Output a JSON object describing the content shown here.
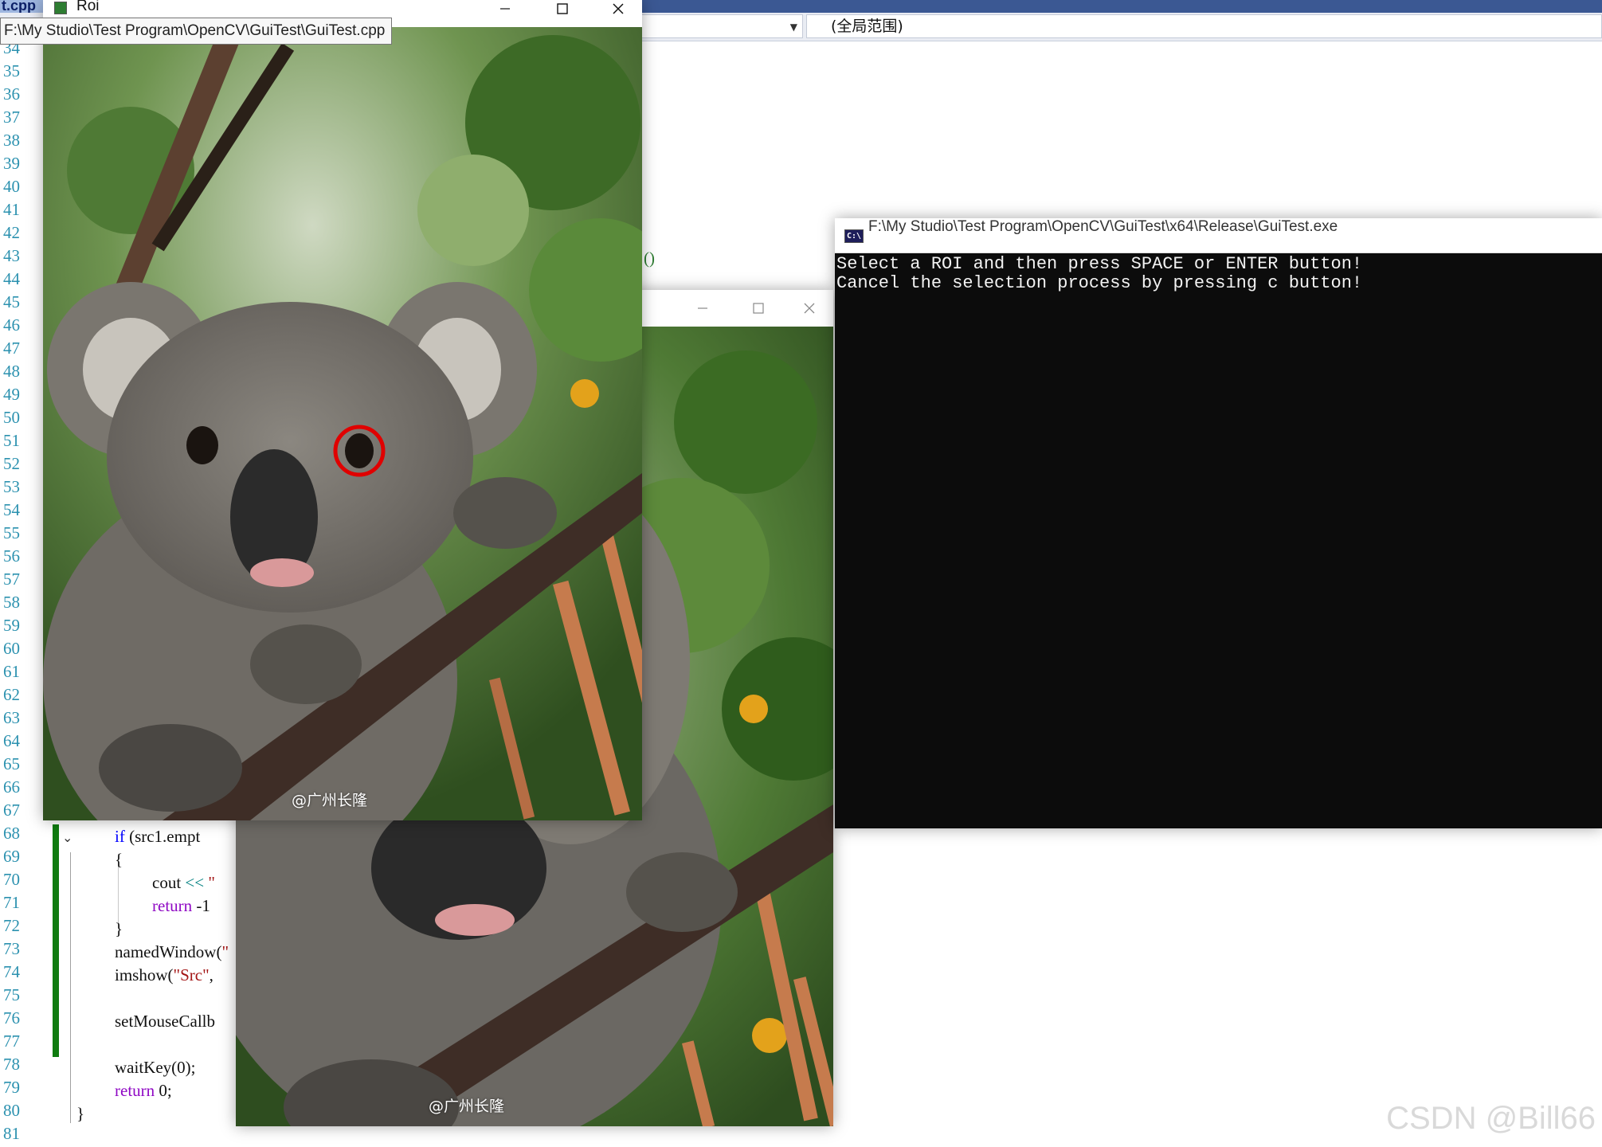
{
  "ide": {
    "file_tab_fragment": "t.cpp",
    "scope_dropdown": "(全局范围)",
    "line_numbers": [
      "34",
      "35",
      "36",
      "37",
      "38",
      "39",
      "40",
      "41",
      "42",
      "43",
      "44",
      "45",
      "46",
      "47",
      "48",
      "49",
      "50",
      "51",
      "52",
      "53",
      "54",
      "55",
      "56",
      "57",
      "58",
      "59",
      "60",
      "61",
      "62",
      "63",
      "64",
      "65",
      "66",
      "67",
      "68",
      "69",
      "70",
      "71",
      "72",
      "73",
      "74",
      "75",
      "76",
      "77",
      "78",
      "79",
      "80",
      "81"
    ],
    "hidden_line_fragment": "()",
    "code": {
      "l68_kw": "if",
      "l68_rest": " (src1.empt",
      "l69": "{",
      "l70_a": "cout ",
      "l70_op": "<<",
      "l70_str": " \"",
      "l71_kw": "return",
      "l71_rest": " -1",
      "l72": "}",
      "l73_a": "namedWindow(",
      "l73_str": "\"",
      "l74_a": "imshow(",
      "l74_str": "\"Src\"",
      "l74_b": ",",
      "l76": "setMouseCallb",
      "l78": "waitKey(0);",
      "l79_kw": "return",
      "l79_rest": " 0;",
      "l80": "}"
    }
  },
  "roi_window": {
    "title": "Roi",
    "tooltip": "F:\\My Studio\\Test Program\\OpenCV\\GuiTest\\GuiTest.cpp",
    "photo_tag": "@广州长隆"
  },
  "src_window": {
    "photo_tag": "@广州长隆"
  },
  "console": {
    "title": "F:\\My Studio\\Test Program\\OpenCV\\GuiTest\\x64\\Release\\GuiTest.exe",
    "line1": "Select a ROI and then press SPACE or ENTER button!",
    "line2": "Cancel the selection process by pressing c button!"
  },
  "watermark": "CSDN @Bill66",
  "colors": {
    "ide_topbar": "#3b5893",
    "line_numbers": "#2b91af",
    "keyword": "#0000ff",
    "change_bar": "#107c10",
    "roi_circle": "#e00000",
    "console_bg": "#0c0c0c"
  }
}
